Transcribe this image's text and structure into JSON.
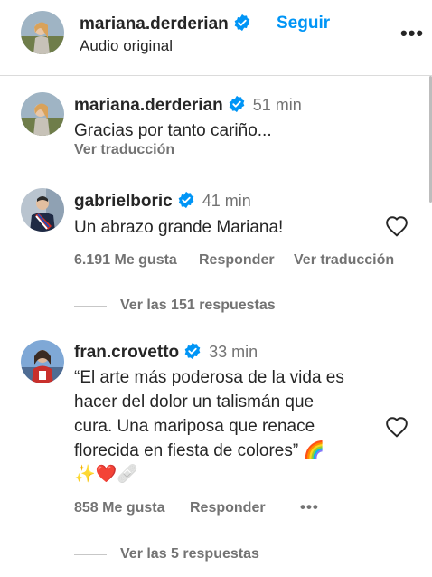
{
  "header": {
    "username": "mariana.derderian",
    "follow_label": "Seguir",
    "subtitle": "Audio original",
    "more_label": "•••"
  },
  "comments": [
    {
      "username": "mariana.derderian",
      "time": "51 min",
      "text": "Gracias por tanto cariño...",
      "translate_label": "Ver traducción"
    },
    {
      "username": "gabrielboric",
      "time": "41 min",
      "text": "Un abrazo grande Mariana!",
      "likes": "6.191 Me gusta",
      "reply_label": "Responder",
      "translate_label": "Ver traducción",
      "view_replies": "Ver las 151 respuestas"
    },
    {
      "username": "fran.crovetto",
      "time": "33 min",
      "text_lines": [
        "“El arte más poderosa de la vida es",
        "hacer del dolor un talismán que",
        "cura. Una mariposa que renace",
        "florecida en fiesta de colores”"
      ],
      "emoji_rainbow": "🌈",
      "emoji_line": "✨❤️🩹",
      "likes": "858 Me gusta",
      "reply_label": "Responder",
      "more_label": "•••",
      "view_replies": "Ver las 5 respuestas"
    }
  ],
  "colors": {
    "accent": "#0095f6",
    "verified": "#0095f6",
    "secondary_text": "#737373"
  }
}
